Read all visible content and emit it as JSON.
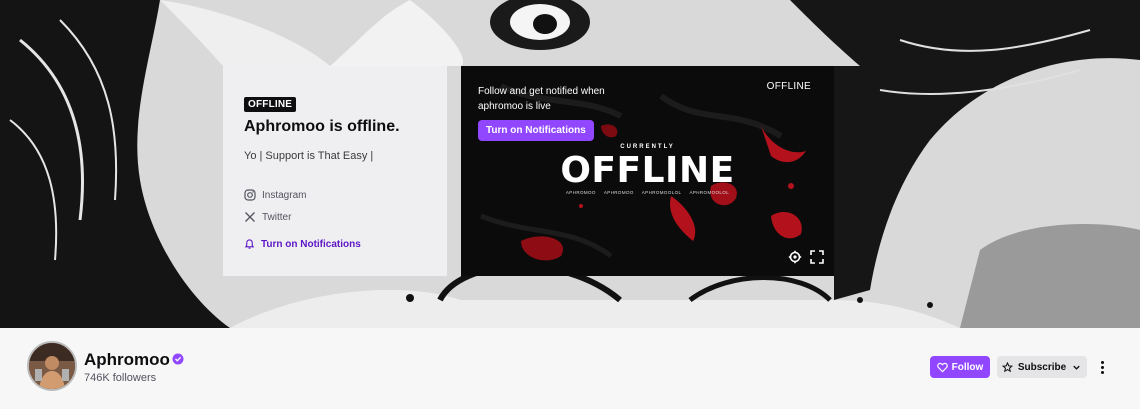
{
  "info_card": {
    "badge": "OFFLINE",
    "title": "Aphromoo is offline.",
    "description": "Yo | Support is That Easy |",
    "socials": [
      {
        "label": "Instagram",
        "icon": "instagram-icon"
      },
      {
        "label": "Twitter",
        "icon": "x-twitter-icon"
      }
    ],
    "notif_link": "Turn on Notifications"
  },
  "player": {
    "prompt": "Follow and get notified when aphromoo is live",
    "notif_button": "Turn on Notifications",
    "status": "OFFLINE",
    "art_small": "CURRENTLY",
    "art_big": "OFFLINE",
    "art_handles": [
      "APHROMOO",
      "APHROMOO",
      "APHROMOOLOL",
      "APHROMOOLOL"
    ]
  },
  "channel": {
    "name": "Aphromoo",
    "followers": "746K followers",
    "follow_label": "Follow",
    "subscribe_label": "Subscribe"
  },
  "colors": {
    "accent": "#9147ff",
    "link": "#5c16c5",
    "offline_art_red": "#b3121c"
  }
}
